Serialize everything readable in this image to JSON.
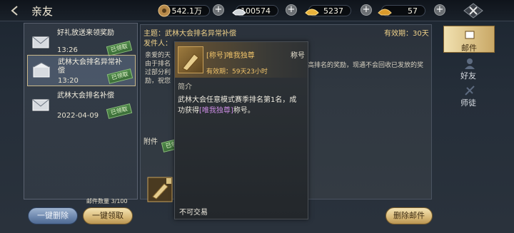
{
  "header": {
    "title": "亲友",
    "currencies": [
      {
        "icon": "copper-coin-icon",
        "value": "542.1万"
      },
      {
        "icon": "silver-ingot-icon",
        "value": "100574"
      },
      {
        "icon": "gold-ingot-icon",
        "value": "5237"
      },
      {
        "icon": "bound-gold-icon",
        "value": "57"
      }
    ]
  },
  "mail_list": {
    "items": [
      {
        "title": "好礼放送来领奖励",
        "date": "13:26",
        "stamp": "已领取"
      },
      {
        "title": "武林大会排名异常补偿",
        "date": "13:20",
        "stamp": "已领取"
      },
      {
        "title": "武林大会排名补偿",
        "date": "2022-04-09",
        "stamp": "已领取"
      }
    ],
    "count_label": "邮件数量 3/100",
    "delete_all": "一键删除",
    "claim_all": "一键领取"
  },
  "mail_detail": {
    "subject": "主题：武林大会排名异常补偿",
    "expiry": "有效期：30天",
    "sender": "发件人：",
    "body_left": "亲爱的天由于排名过部分利励，祝您",
    "body_right": "高排名的奖励，现通不会回收已发放的奖",
    "attachment_label": "附件",
    "attachment_stamp": "已领取",
    "delete_button": "删除邮件"
  },
  "tabs": [
    {
      "label": "邮件",
      "active": true
    },
    {
      "label": "好友",
      "active": false
    },
    {
      "label": "师徒",
      "active": false
    }
  ],
  "tooltip": {
    "name": "[称号]唯我独尊",
    "type": "称号",
    "validity": "有效期：59天23小时",
    "section": "简介",
    "desc_prefix": "武林大会任意模式赛季排名第1名，成功获得",
    "desc_highlight": "[唯我独尊]",
    "desc_suffix": "称号。",
    "footer": "不可交易"
  }
}
